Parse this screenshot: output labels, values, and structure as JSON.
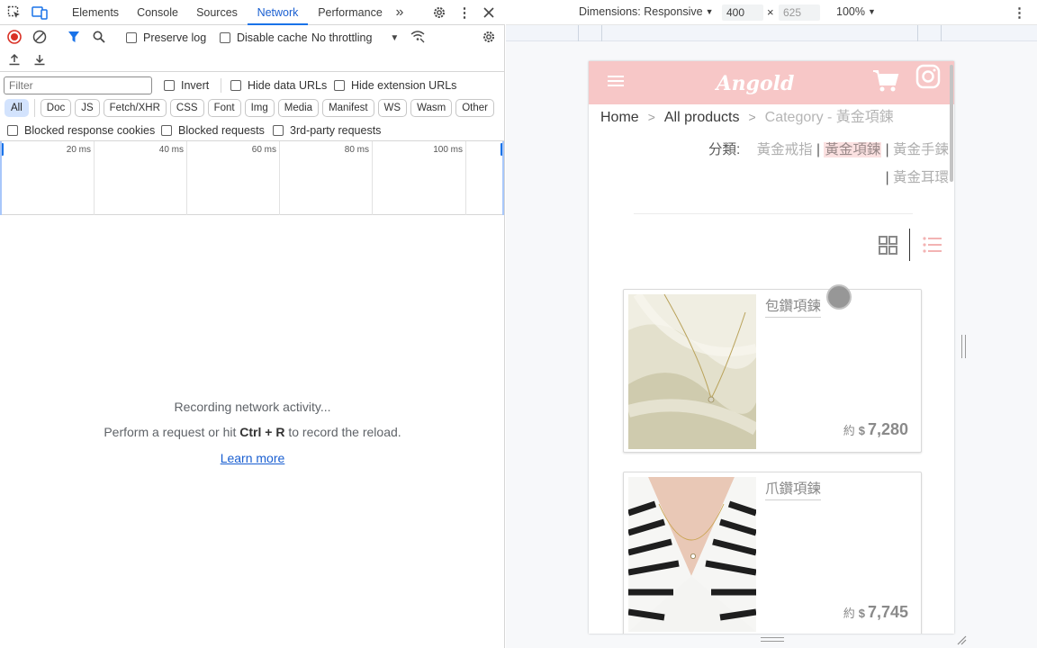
{
  "devtools": {
    "tabs": [
      {
        "label": "Elements"
      },
      {
        "label": "Console"
      },
      {
        "label": "Sources"
      },
      {
        "label": "Network"
      },
      {
        "label": "Performance"
      }
    ],
    "active_tab": "Network",
    "toolbar": {
      "preserve_log": "Preserve log",
      "disable_cache": "Disable cache",
      "throttling": "No throttling"
    },
    "filter": {
      "placeholder": "Filter",
      "invert": "Invert",
      "hide_data_urls": "Hide data URLs",
      "hide_extension_urls": "Hide extension URLs"
    },
    "type_filters": [
      "All",
      "Doc",
      "JS",
      "Fetch/XHR",
      "CSS",
      "Font",
      "Img",
      "Media",
      "Manifest",
      "WS",
      "Wasm",
      "Other"
    ],
    "active_type_filter": "All",
    "extra_filters": {
      "blocked_cookies": "Blocked response cookies",
      "blocked_requests": "Blocked requests",
      "third_party": "3rd-party requests"
    },
    "timeline_labels": [
      "20 ms",
      "40 ms",
      "60 ms",
      "80 ms",
      "100 ms"
    ],
    "empty_state": {
      "line1": "Recording network activity...",
      "line2_prefix": "Perform a request or hit ",
      "shortcut": "Ctrl + R",
      "line2_suffix": " to record the reload.",
      "learn_more": "Learn more"
    }
  },
  "device_toolbar": {
    "dimensions_label": "Dimensions: Responsive",
    "width": "400",
    "times": "×",
    "height": "625",
    "zoom": "100%"
  },
  "site": {
    "brand": "Angold",
    "breadcrumb": {
      "home": "Home",
      "sep1": ">",
      "all_products": "All products",
      "sep2": ">",
      "category": "Category - 黃金項鍊"
    },
    "categories": {
      "label": "分類:",
      "items": [
        "黃金戒指",
        "黃金項鍊",
        "黃金手鍊",
        "黃金耳環"
      ],
      "separator": "|",
      "active": "黃金項鍊"
    },
    "products": [
      {
        "title": "包鑽項鍊",
        "price_prefix": "約",
        "currency": "$",
        "price": "7,280"
      },
      {
        "title": "爪鑽項鍊",
        "price_prefix": "約",
        "currency": "$",
        "price": "7,745"
      }
    ]
  },
  "colors": {
    "header_pink": "#f7c7c7",
    "active_tab_blue": "#1a73e8",
    "record_red": "#d93025"
  }
}
